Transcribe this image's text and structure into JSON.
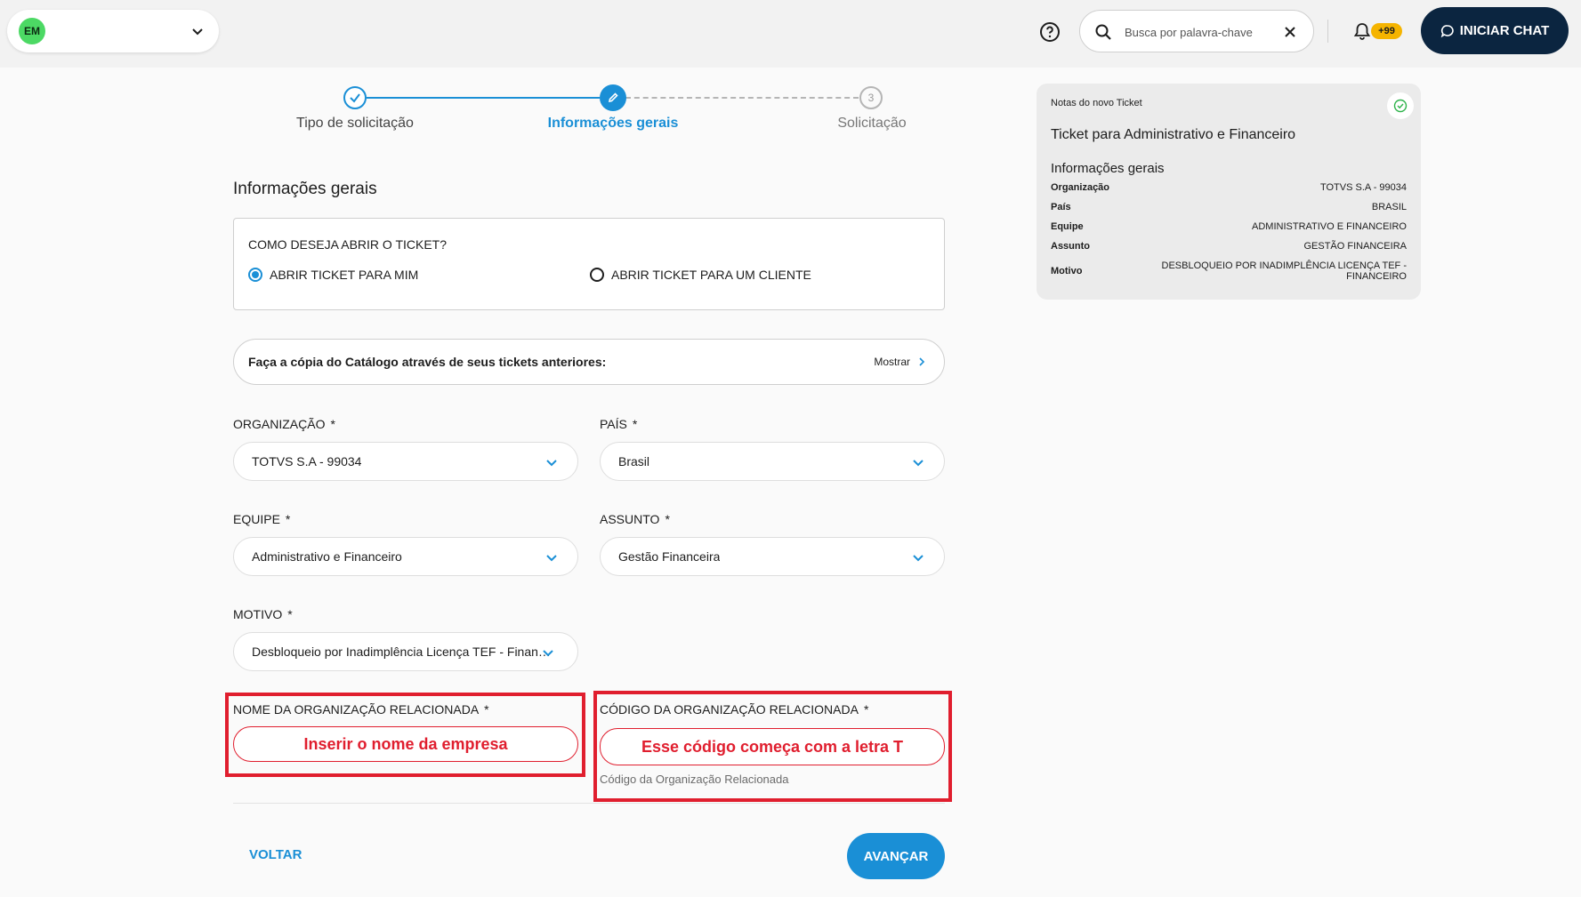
{
  "topbar": {
    "avatar_initials": "EM",
    "search_placeholder": "Busca por palavra-chave",
    "notification_count": "+99",
    "chat_button_label": "INICIAR CHAT"
  },
  "stepper": {
    "steps": [
      {
        "label": "Tipo de solicitação",
        "state": "done"
      },
      {
        "label": "Informações gerais",
        "state": "active"
      },
      {
        "label": "Solicitação",
        "state": "pending",
        "number": "3"
      }
    ]
  },
  "form": {
    "section_title": "Informações gerais",
    "ticket_question": "COMO DESEJA ABRIR O TICKET?",
    "radio_options": [
      {
        "label": "ABRIR TICKET PARA MIM",
        "checked": true
      },
      {
        "label": "ABRIR TICKET PARA UM CLIENTE",
        "checked": false
      }
    ],
    "catalog_text": "Faça a cópia do Catálogo através de seus tickets anteriores:",
    "catalog_show_label": "Mostrar",
    "required_mark": "*",
    "fields": {
      "organizacao": {
        "label": "ORGANIZAÇÃO",
        "value": "TOTVS S.A - 99034"
      },
      "pais": {
        "label": "PAÍS",
        "value": "Brasil"
      },
      "equipe": {
        "label": "EQUIPE",
        "value": "Administrativo e Financeiro"
      },
      "assunto": {
        "label": "ASSUNTO",
        "value": "Gestão Financeira"
      },
      "motivo": {
        "label": "MOTIVO",
        "value": "Desbloqueio por Inadimplência Licença TEF - Financeiro"
      },
      "nome_org": {
        "label": "NOME DA ORGANIZAÇÃO RELACIONADA",
        "annotation": "Inserir o nome da empresa"
      },
      "codigo_org": {
        "label": "CÓDIGO DA ORGANIZAÇÃO RELACIONADA",
        "annotation": "Esse código começa com a letra T",
        "helper": "Código da Organização Relacionada"
      }
    },
    "back_label": "VOLTAR",
    "next_label": "AVANÇAR"
  },
  "notes": {
    "header": "Notas do novo Ticket",
    "title": "Ticket para Administrativo e Financeiro",
    "subtitle": "Informações gerais",
    "rows": [
      {
        "key": "Organização",
        "value": "TOTVS S.A - 99034"
      },
      {
        "key": "País",
        "value": "BRASIL"
      },
      {
        "key": "Equipe",
        "value": "ADMINISTRATIVO E FINANCEIRO"
      },
      {
        "key": "Assunto",
        "value": "GESTÃO FINANCEIRA"
      },
      {
        "key": "Motivo",
        "value": "DESBLOQUEIO POR INADIMPLÊNCIA LICENÇA TEF - FINANCEIRO"
      }
    ]
  },
  "colors": {
    "accent": "#1a8fd6",
    "dark_navy": "#0b2540",
    "annotation_red": "#e01e2e",
    "badge_yellow": "#f5b400",
    "avatar_green": "#4cd964"
  },
  "icons": [
    "chevron-down-icon",
    "help-icon",
    "search-icon",
    "close-icon",
    "bell-icon",
    "chat-bubble-icon",
    "check-icon",
    "pencil-icon",
    "chevron-right-icon",
    "check-circle-icon"
  ]
}
